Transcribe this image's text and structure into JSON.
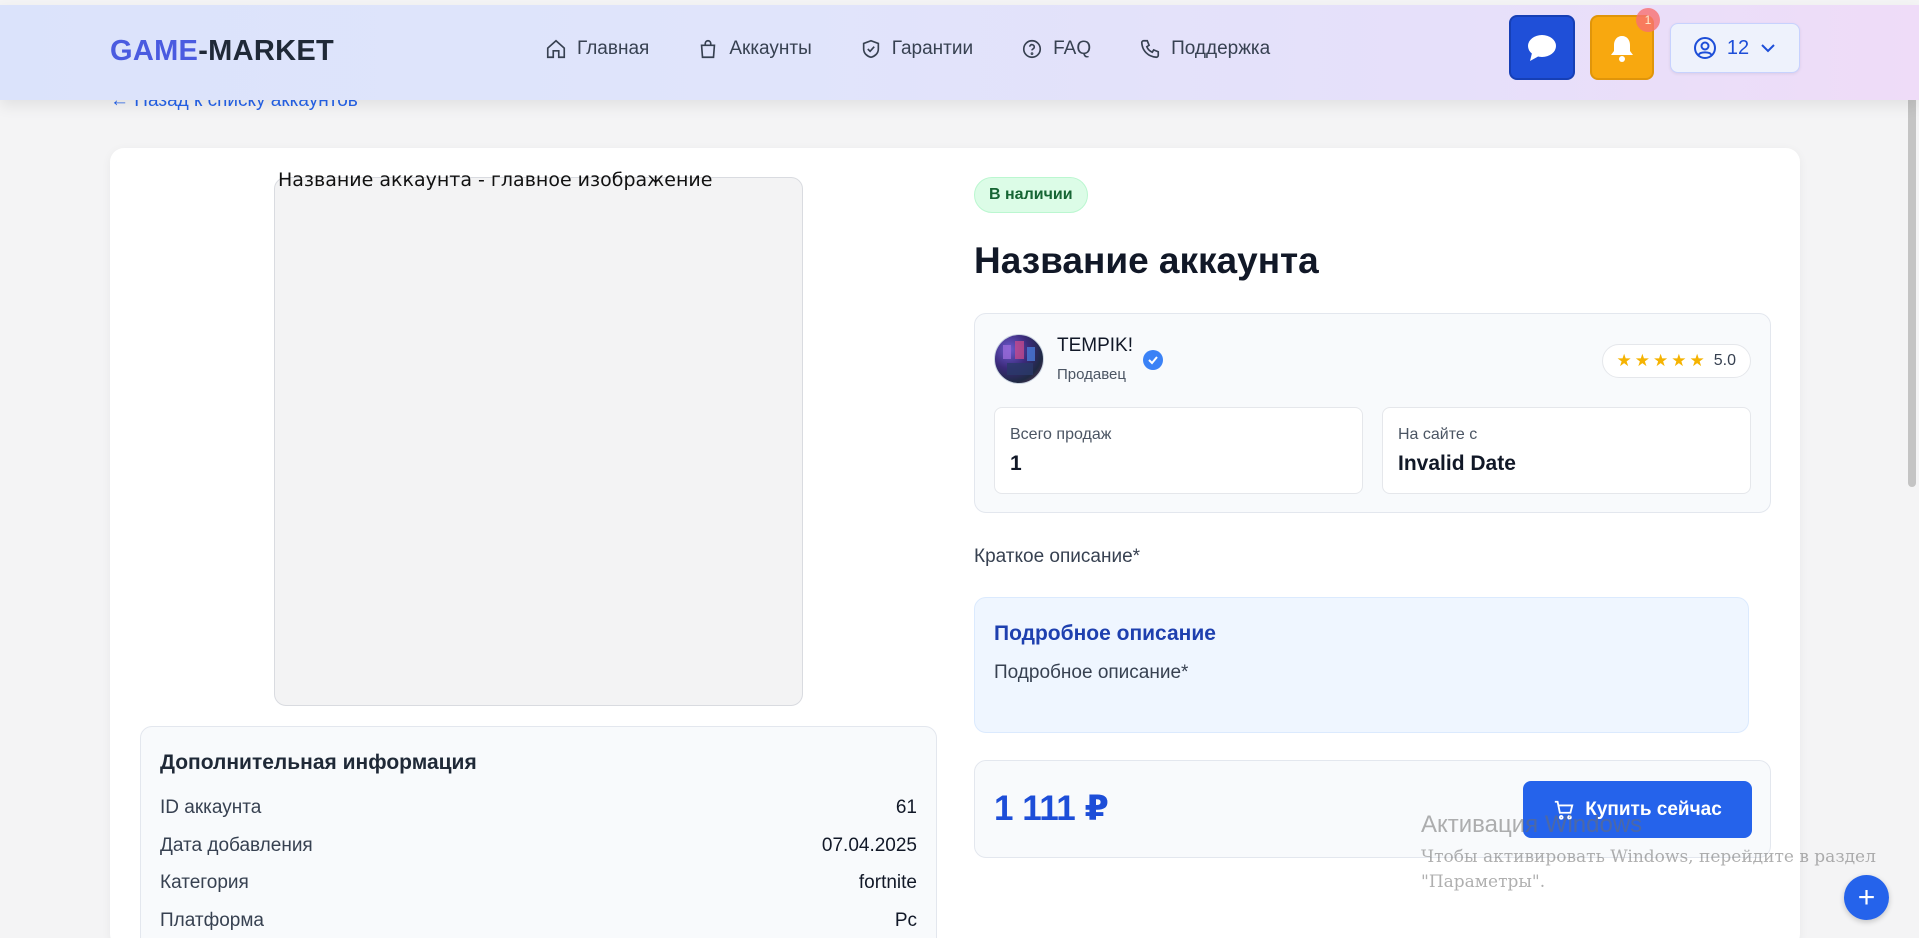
{
  "header": {
    "logo_part1": "GAME",
    "logo_part2": "-MARKET",
    "nav": [
      {
        "label": "Главная",
        "icon": "home-icon"
      },
      {
        "label": "Аккаунты",
        "icon": "shopping-bag-icon"
      },
      {
        "label": "Гарантии",
        "icon": "shield-check-icon"
      },
      {
        "label": "FAQ",
        "icon": "help-circle-icon"
      },
      {
        "label": "Поддержка",
        "icon": "phone-icon"
      }
    ],
    "notifications_count": "1",
    "user_balance": "12",
    "colors": {
      "chat": "#1f4fd8",
      "bell": "#f8a80f",
      "accent": "#2563eb"
    }
  },
  "back_link": "← Назад к списку аккаунтов",
  "product": {
    "image_alt": "Название аккаунта - главное изображение",
    "status": "В наличии",
    "title": "Название аккаунта",
    "short_description": "Краткое описание*",
    "detailed_title": "Подробное описание",
    "detailed_text": "Подробное описание*",
    "price": "1 111 ₽",
    "buy_label": "Купить сейчас"
  },
  "seller": {
    "name": "TEMPIK!",
    "role": "Продавец",
    "rating": "5.0",
    "stars": 5,
    "sales_label": "Всего продаж",
    "sales_value": "1",
    "since_label": "На сайте с",
    "since_value": "Invalid Date"
  },
  "additional_info": {
    "title": "Дополнительная информация",
    "rows": [
      {
        "label": "ID аккаунта",
        "value": "61"
      },
      {
        "label": "Дата добавления",
        "value": "07.04.2025"
      },
      {
        "label": "Категория",
        "value": "fortnite"
      },
      {
        "label": "Платформа",
        "value": "Pc"
      }
    ]
  },
  "watermark": {
    "title": "Активация Windows",
    "line1": "Чтобы активировать Windows, перейдите в раздел",
    "line2": "\"Параметры\"."
  },
  "fab_label": "+"
}
